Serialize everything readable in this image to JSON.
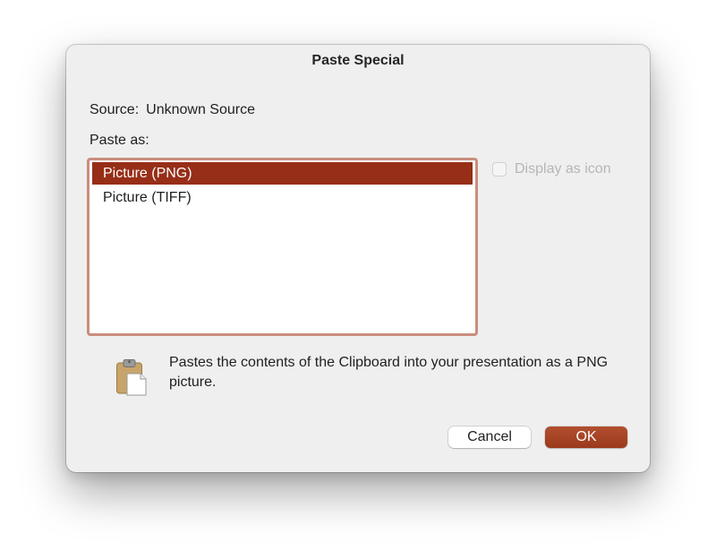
{
  "dialog": {
    "title": "Paste Special",
    "source_label": "Source:",
    "source_value": "Unknown Source",
    "paste_as_label": "Paste as:",
    "options": [
      {
        "label": "Picture (PNG)",
        "selected": true
      },
      {
        "label": "Picture (TIFF)",
        "selected": false
      }
    ],
    "display_as_icon": {
      "label": "Display as icon",
      "checked": false,
      "enabled": false
    },
    "result_icon": "clipboard-icon",
    "result_text": "Pastes the contents of the Clipboard into your presentation as a PNG picture.",
    "cancel_label": "Cancel",
    "ok_label": "OK"
  },
  "colors": {
    "accent": "#972e17",
    "list_border": "#c98d7e",
    "dialog_bg": "#efefef"
  }
}
